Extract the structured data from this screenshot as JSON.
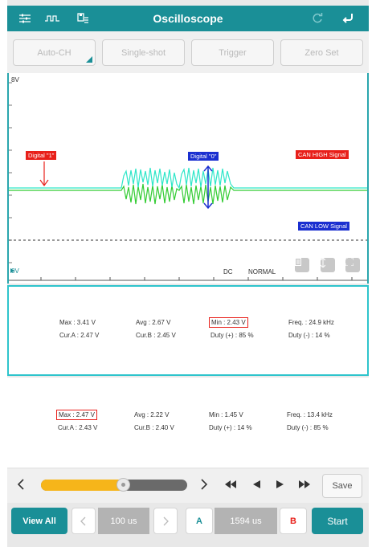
{
  "app": {
    "title": "Oscilloscope"
  },
  "toolbar": {
    "left_icons": [
      "settings-sliders-icon",
      "signal-pulse-icon",
      "save-list-icon"
    ],
    "right_icons": [
      "refresh-icon",
      "back-arrow-icon"
    ]
  },
  "mode_buttons": {
    "auto_ch": "Auto-CH",
    "single_shot": "Single-shot",
    "trigger": "Trigger",
    "zero_set": "Zero Set"
  },
  "scope": {
    "top_label": "8V",
    "zero_label": "0V",
    "annotations": {
      "digital_one": "Digital \"1\"",
      "digital_zero": "Digital \"0\"",
      "can_high": "CAN HIGH Signal",
      "can_low": "CAN LOW Signal"
    },
    "coupling": "DC",
    "mode": "NORMAL",
    "trace_colors": {
      "can_high": "#2ee6c8",
      "can_low": "#33cc33",
      "annotation_red": "#e8201a",
      "annotation_blue": "#1a2fd0"
    }
  },
  "channel_a": {
    "max": "Max : 3.41 V",
    "cur": "Cur.A : 2.47 V",
    "avg": "Avg : 2.67 V",
    "curb": "Cur.B : 2.45 V",
    "min": "Min : 2.43 V",
    "duty_pos": "Duty (+) : 85 %",
    "freq": "Freq. : 24.9 kHz",
    "duty_neg": "Duty (-) : 14 %"
  },
  "channel_b": {
    "max": "Max : 2.47 V",
    "cur": "Cur.A : 2.43 V",
    "avg": "Avg : 2.22 V",
    "curb": "Cur.B : 2.40 V",
    "min": "Min : 1.45 V",
    "duty_pos": "Duty (+) : 14 %",
    "freq": "Freq. : 13.4 kHz",
    "duty_neg": "Duty (-) : 85 %"
  },
  "playback": {
    "position": 0.56,
    "save": "Save"
  },
  "bottom": {
    "view_all": "View All",
    "timebase": "100 us",
    "cursor_a": "A",
    "cursor_delta": "1594 us",
    "cursor_b": "B",
    "start": "Start"
  }
}
